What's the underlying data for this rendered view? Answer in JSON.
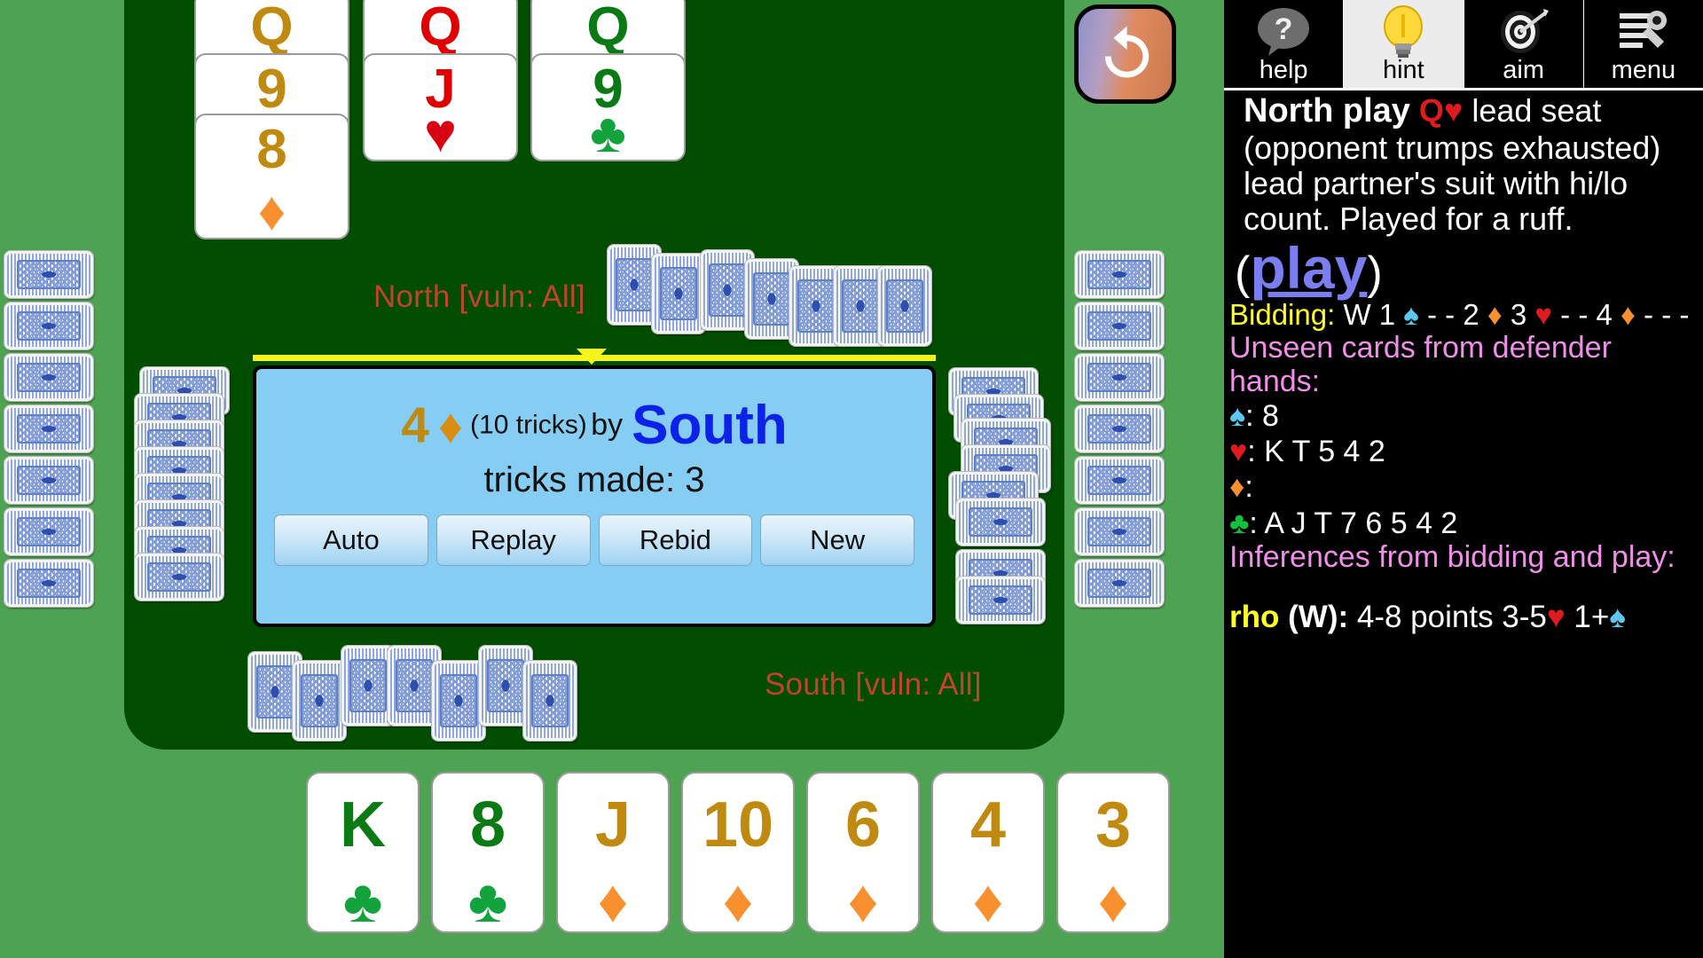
{
  "toolbar": {
    "buttons": [
      {
        "label": "help",
        "icon": "question-speech-bubble-icon",
        "active": false
      },
      {
        "label": "hint",
        "icon": "lightbulb-icon",
        "active": true
      },
      {
        "label": "aim",
        "icon": "dartboard-icon",
        "active": false
      },
      {
        "label": "menu",
        "icon": "menu-wrench-icon",
        "active": false
      }
    ]
  },
  "undo": {
    "icon": "undo-arrow-icon",
    "label": "undo"
  },
  "hint": {
    "head_actor": "North play",
    "head_card_rank": "Q",
    "head_card_suit": "♥",
    "head_rest": "lead seat (opponent trumps exhausted) lead partner's suit with hi/lo count. Played for a ruff.",
    "play_open_paren": "(",
    "play_link": "play",
    "play_close_paren": ")",
    "bidding_label": "Bidding:",
    "bidding_seq": "W  1♠ - - 2♦ 3♥ - - 4♦ - - -",
    "bidding_tokens": [
      {
        "t": "W",
        "c": "white"
      },
      {
        "t": "1",
        "c": "white"
      },
      {
        "t": "♠",
        "c": "spade"
      },
      {
        "t": "- -",
        "c": "white"
      },
      {
        "t": "2",
        "c": "white"
      },
      {
        "t": "♦",
        "c": "diamond"
      },
      {
        "t": "3",
        "c": "white"
      },
      {
        "t": "♥",
        "c": "heart"
      },
      {
        "t": "- -",
        "c": "white"
      },
      {
        "t": "4",
        "c": "white"
      },
      {
        "t": "♦",
        "c": "diamond"
      },
      {
        "t": "- - -",
        "c": "white"
      }
    ],
    "unseen_title": "Unseen cards from defender hands:",
    "unseen": [
      {
        "suit": "♠",
        "suit_class": "spade",
        "cards": ": 8"
      },
      {
        "suit": "♥",
        "suit_class": "heart",
        "cards": ": K T 5 4 2"
      },
      {
        "suit": "♦",
        "suit_class": "diamond",
        "cards": ":"
      },
      {
        "suit": "♣",
        "suit_class": "club",
        "cards": ": A J T 7 6 5 4 2"
      }
    ],
    "inferences_title": "Inferences from bidding and play:",
    "rho_tag": "rho",
    "rho_seat": "(W):",
    "rho_text_a": "4-8 points 3-5",
    "rho_heart": "♥",
    "rho_text_b": "1+",
    "rho_spade": "♠"
  },
  "table": {
    "north_label": "North [vuln: All]",
    "south_label": "South [vuln: All]"
  },
  "dialog": {
    "contract_level": "4",
    "contract_suit": "♦",
    "tricks_note": "(10 tricks)",
    "by_word": "by",
    "declarer": "South",
    "tricks_made": "tricks made: 3",
    "buttons": [
      {
        "label": "Auto"
      },
      {
        "label": "Replay"
      },
      {
        "label": "Rebid"
      },
      {
        "label": "New"
      }
    ]
  },
  "trick_cards": [
    {
      "rank": "Q",
      "suit": "♦",
      "suit_class": "d",
      "show_pip": false
    },
    {
      "rank": "9",
      "suit": "♦",
      "suit_class": "d",
      "show_pip": false
    },
    {
      "rank": "8",
      "suit": "♦",
      "suit_class": "d",
      "show_pip": true
    },
    {
      "rank": "Q",
      "suit": "♥",
      "suit_class": "h",
      "show_pip": false
    },
    {
      "rank": "J",
      "suit": "♥",
      "suit_class": "h",
      "show_pip": true
    },
    {
      "rank": "Q",
      "suit": "♣",
      "suit_class": "c",
      "show_pip": false
    },
    {
      "rank": "9",
      "suit": "♣",
      "suit_class": "c",
      "show_pip": true
    }
  ],
  "hand_cards": [
    {
      "rank": "K",
      "suit": "♣",
      "suit_class": "c"
    },
    {
      "rank": "8",
      "suit": "♣",
      "suit_class": "c"
    },
    {
      "rank": "J",
      "suit": "♦",
      "suit_class": "d"
    },
    {
      "rank": "10",
      "suit": "♦",
      "suit_class": "d"
    },
    {
      "rank": "6",
      "suit": "♦",
      "suit_class": "d"
    },
    {
      "rank": "4",
      "suit": "♦",
      "suit_class": "d"
    },
    {
      "rank": "3",
      "suit": "♦",
      "suit_class": "d"
    }
  ],
  "colors": {
    "felt": "#004d00",
    "surround": "#4ea352",
    "dialog_bg": "#86cdf4",
    "spade": "#5cc8f0",
    "heart": "#e01b20",
    "diamond": "#f8902f",
    "club": "#12c23c",
    "declarer_blue": "#0d22e8",
    "seat_label": "#c0432a",
    "accent_yellow": "#ffff22"
  }
}
